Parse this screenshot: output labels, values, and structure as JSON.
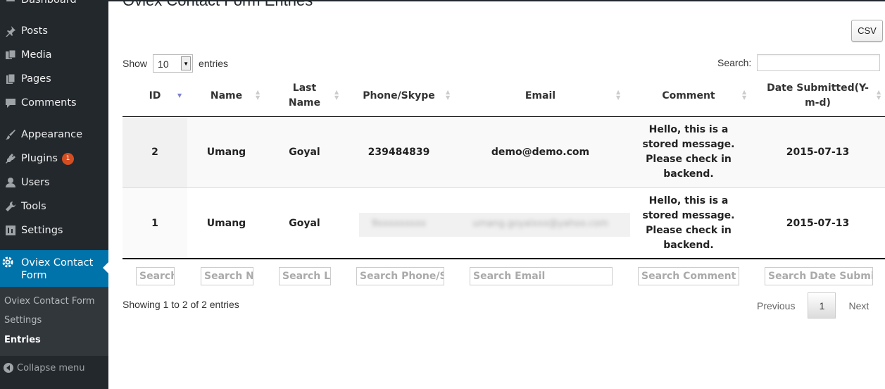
{
  "sidebar": {
    "items": [
      {
        "label": "Dashboard",
        "icon": "dashboard-icon"
      },
      {
        "label": "Posts",
        "icon": "pin-icon"
      },
      {
        "label": "Media",
        "icon": "media-icon"
      },
      {
        "label": "Pages",
        "icon": "pages-icon"
      },
      {
        "label": "Comments",
        "icon": "comments-icon"
      },
      {
        "label": "Appearance",
        "icon": "brush-icon"
      },
      {
        "label": "Plugins",
        "icon": "plugin-icon",
        "badge": "1"
      },
      {
        "label": "Users",
        "icon": "user-icon"
      },
      {
        "label": "Tools",
        "icon": "wrench-icon"
      },
      {
        "label": "Settings",
        "icon": "settings-icon"
      }
    ],
    "active": {
      "label": "Oviex Contact Form",
      "icon": "gear-icon"
    },
    "submenu": [
      {
        "label": "Oviex Contact Form"
      },
      {
        "label": "Settings"
      },
      {
        "label": "Entries",
        "current": true
      }
    ],
    "collapse_label": "Collapse menu"
  },
  "page": {
    "title": "Oviex Contact Form Entries",
    "csv_label": "CSV"
  },
  "table_controls": {
    "show_label": "Show",
    "entries_label": "entries",
    "length_value": "10",
    "search_label": "Search:",
    "search_value": ""
  },
  "table": {
    "columns": [
      "ID",
      "Name",
      "Last Name",
      "Phone/Skype",
      "Email",
      "Comment",
      "Date Submitted(Y-m-d)"
    ],
    "rows": [
      {
        "id": "2",
        "name": "Umang",
        "last_name": "Goyal",
        "phone": "239484839",
        "email": "demo@demo.com",
        "comment": "Hello, this is a stored message. Please check in backend.",
        "date": "2015-07-13"
      },
      {
        "id": "1",
        "name": "Umang",
        "last_name": "Goyal",
        "phone": "9xxxxxxxxx",
        "email": "umang.goyalxxx@yahoo.com",
        "comment": "Hello, this is a stored message. Please check in backend.",
        "date": "2015-07-13"
      }
    ],
    "column_search_placeholders": [
      "Search ID",
      "Search Name",
      "Search Last Name",
      "Search Phone/Skype",
      "Search Email",
      "Search Comment",
      "Search Date Submitted(Y-m-d)"
    ]
  },
  "footer": {
    "info": "Showing 1 to 2 of 2 entries",
    "previous_label": "Previous",
    "page_number": "1",
    "next_label": "Next"
  },
  "colors": {
    "sidebar_bg": "#23282d",
    "active_bg": "#0073aa",
    "badge_bg": "#d54e21"
  }
}
